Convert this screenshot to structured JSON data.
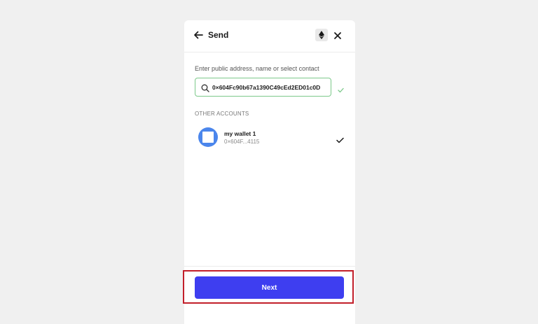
{
  "header": {
    "title": "Send",
    "back_icon": "arrow-left-icon",
    "network_icon": "ethereum-icon",
    "close_icon": "close-icon"
  },
  "recipient": {
    "label": "Enter public address, name or select contact",
    "value": "0×604Fc90b67a1390C49cEd2ED01c0D",
    "search_icon": "search-icon",
    "status_icon": "check-icon",
    "valid_color": "#7cc98a"
  },
  "accounts": {
    "section_label": "OTHER ACCOUNTS",
    "items": [
      {
        "name": "my wallet 1",
        "address": "0×604F...4115",
        "selected": true,
        "avatar_color": "#4b86ec"
      }
    ]
  },
  "footer": {
    "next_label": "Next",
    "button_color": "#3e3ef0",
    "highlight_color": "#c21f2a"
  }
}
